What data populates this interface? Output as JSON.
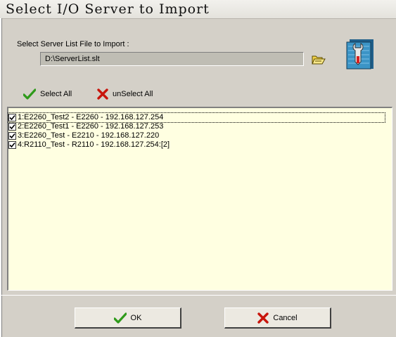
{
  "window": {
    "title": "Select I/O Server to Import"
  },
  "file_select": {
    "label": "Select Server List File to Import :",
    "path_value": "D:\\ServerList.slt",
    "browse_icon": "folder-open-icon",
    "tools_icon": "tools-wrench-icon"
  },
  "actions": {
    "select_all_label": "Select All",
    "unselect_all_label": "unSelect All"
  },
  "servers": [
    {
      "label": "1:E2260_Test2 - E2260 - 192.168.127.254",
      "checked": true
    },
    {
      "label": "2:E2260_Test1 - E2260 - 192.168.127.253",
      "checked": true
    },
    {
      "label": "3:E2260_Test - E2210 - 192.168.127.220",
      "checked": true
    },
    {
      "label": "4:R2110_Test - R2110 - 192.168.127.254:[2]",
      "checked": true
    }
  ],
  "buttons": {
    "ok_label": "OK",
    "cancel_label": "Cancel"
  },
  "colors": {
    "dialog_bg": "#d4d0c8",
    "list_bg": "#ffffe1",
    "check_green": "#2e9a1a",
    "cross_red": "#c8150c"
  }
}
